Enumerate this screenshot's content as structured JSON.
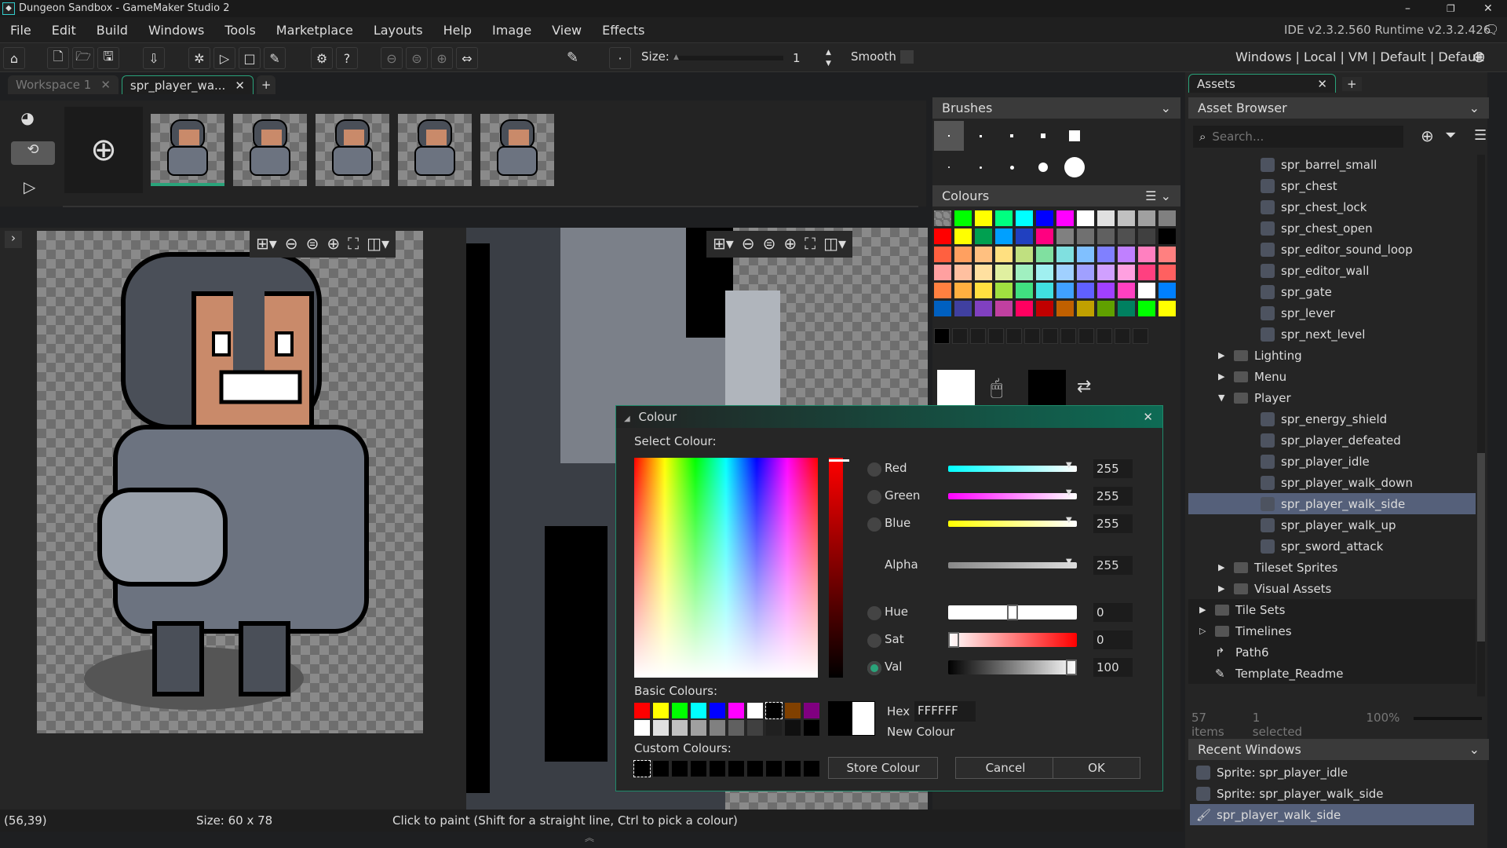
{
  "window": {
    "title": "Dungeon Sandbox - GameMaker Studio 2",
    "version": "IDE v2.3.2.560  Runtime v2.3.2.426"
  },
  "menu": [
    "File",
    "Edit",
    "Build",
    "Windows",
    "Tools",
    "Marketplace",
    "Layouts",
    "Help",
    "Image",
    "View",
    "Effects"
  ],
  "toolbar": {
    "size_label": "Size:",
    "size_value": "1",
    "smooth_label": "Smooth",
    "target": "Windows | Local | VM | Default | Default"
  },
  "tabs": [
    {
      "label": "Workspace 1"
    },
    {
      "label": "spr_player_wa..."
    }
  ],
  "tab_add": "+",
  "frames": {
    "count": 5,
    "selected": 0
  },
  "brushes": {
    "title": "Brushes"
  },
  "colours": {
    "title": "Colours",
    "palette": [
      "#00ff00",
      "#ffff00",
      "#00ff80",
      "#00ffff",
      "#0000ff",
      "#ff00ff",
      "#ffffff",
      "#e0e0e0",
      "#c0c0c0",
      "#a0a0a0",
      "#808080",
      "#ff0000",
      "#ffff00",
      "#00a050",
      "#00a0ff",
      "#2040c0",
      "#ff0080",
      "#808080",
      "#707070",
      "#606060",
      "#505050",
      "#404040",
      "#000000",
      "#ff6040",
      "#ffa060",
      "#ffc080",
      "#ffe080",
      "#c0e080",
      "#80e0a0",
      "#80e0e0",
      "#80c0ff",
      "#8080ff",
      "#c080ff",
      "#ff80c0",
      "#ff8080",
      "#ffa0a0",
      "#ffc0a0",
      "#ffe0a0",
      "#e0f0a0",
      "#a0f0c0",
      "#a0f0f0",
      "#a0d0ff",
      "#a0a0ff",
      "#d0a0ff",
      "#ffa0e0",
      "#ff4080",
      "#ff6060",
      "#ff8040",
      "#ffb040",
      "#ffe040",
      "#a0e040",
      "#40e080",
      "#40e0e0",
      "#40a0ff",
      "#6060ff",
      "#a040ff",
      "#ff40c0",
      "#ffffff",
      "#0080ff",
      "#0060c0",
      "#4040a0",
      "#8040c0",
      "#c040a0",
      "#ff0060",
      "#c00000",
      "#c06000",
      "#c0a000",
      "#60a000",
      "#008060"
    ]
  },
  "colour_dialog": {
    "title": "Colour",
    "select_label": "Select Colour:",
    "channels": [
      {
        "name": "Red",
        "value": "255",
        "fill": 1.0
      },
      {
        "name": "Green",
        "value": "255",
        "fill": 1.0
      },
      {
        "name": "Blue",
        "value": "255",
        "fill": 1.0
      },
      {
        "name": "Alpha",
        "value": "255",
        "fill": 1.0
      },
      {
        "name": "Hue",
        "value": "0",
        "fill": 0.5
      },
      {
        "name": "Sat",
        "value": "0",
        "fill": 0.0
      },
      {
        "name": "Val",
        "value": "100",
        "fill": 1.0
      }
    ],
    "selected_channel": "Val",
    "basic_label": "Basic Colours:",
    "basic": [
      "#ff0000",
      "#ffff00",
      "#00ff00",
      "#00ffff",
      "#0000ff",
      "#ff00ff",
      "#ffffff",
      "#000000",
      "#804000",
      "#800080",
      "#ffffff",
      "#e0e0e0",
      "#c0c0c0",
      "#a0a0a0",
      "#808080",
      "#606060",
      "#404040",
      "#202020",
      "#101010",
      "#000000"
    ],
    "custom_label": "Custom Colours:",
    "hex_label": "Hex",
    "hex_value": "FFFFFF",
    "new_colour_label": "New Colour",
    "store_button": "Store Colour",
    "cancel_button": "Cancel",
    "ok_button": "OK"
  },
  "assets": {
    "tab": "Assets",
    "browser_title": "Asset Browser",
    "search_placeholder": "Search...",
    "items": [
      {
        "label": "spr_barrel_small",
        "level": 2,
        "icon": "sprite-icon"
      },
      {
        "label": "spr_chest",
        "level": 2,
        "icon": "sprite-icon"
      },
      {
        "label": "spr_chest_lock",
        "level": 2,
        "icon": "sprite-icon"
      },
      {
        "label": "spr_chest_open",
        "level": 2,
        "icon": "sprite-icon"
      },
      {
        "label": "spr_editor_sound_loop",
        "level": 2,
        "icon": "sprite-icon"
      },
      {
        "label": "spr_editor_wall",
        "level": 2,
        "icon": "sprite-icon"
      },
      {
        "label": "spr_gate",
        "level": 2,
        "icon": "sprite-icon"
      },
      {
        "label": "spr_lever",
        "level": 2,
        "icon": "sprite-icon"
      },
      {
        "label": "spr_next_level",
        "level": 2,
        "icon": "sprite-icon"
      },
      {
        "label": "Lighting",
        "level": 1,
        "icon": "folder-icon",
        "expand": "closed"
      },
      {
        "label": "Menu",
        "level": 1,
        "icon": "folder-icon",
        "expand": "closed"
      },
      {
        "label": "Player",
        "level": 1,
        "icon": "folder-icon",
        "expand": "open"
      },
      {
        "label": "spr_energy_shield",
        "level": 2,
        "icon": "sprite-icon"
      },
      {
        "label": "spr_player_defeated",
        "level": 2,
        "icon": "sprite-icon"
      },
      {
        "label": "spr_player_idle",
        "level": 2,
        "icon": "sprite-icon"
      },
      {
        "label": "spr_player_walk_down",
        "level": 2,
        "icon": "sprite-icon"
      },
      {
        "label": "spr_player_walk_side",
        "level": 2,
        "icon": "sprite-icon",
        "selected": true
      },
      {
        "label": "spr_player_walk_up",
        "level": 2,
        "icon": "sprite-icon"
      },
      {
        "label": "spr_sword_attack",
        "level": 2,
        "icon": "sprite-icon"
      },
      {
        "label": "Tileset Sprites",
        "level": 1,
        "icon": "folder-icon",
        "expand": "closed"
      },
      {
        "label": "Visual Assets",
        "level": 1,
        "icon": "folder-icon",
        "expand": "closed"
      },
      {
        "label": "Tile Sets",
        "level": 0,
        "icon": "folder-icon",
        "expand": "closed"
      },
      {
        "label": "Timelines",
        "level": 0,
        "icon": "folder-icon",
        "expand": "empty"
      },
      {
        "label": "Path6",
        "level": 0,
        "icon": "path-icon"
      },
      {
        "label": "Template_Readme",
        "level": 0,
        "icon": "note-icon"
      }
    ],
    "count": "57 items",
    "selected": "1 selected",
    "zoom": "100%"
  },
  "recent": {
    "title": "Recent Windows",
    "items": [
      "Sprite: spr_player_idle",
      "Sprite: spr_player_walk_side",
      "spr_player_walk_side"
    ],
    "selected": 2
  },
  "status": {
    "coords": "(56,39)",
    "size": "Size: 60 x 78",
    "hint": "Click to paint (Shift for a straight line, Ctrl to pick a colour)"
  }
}
